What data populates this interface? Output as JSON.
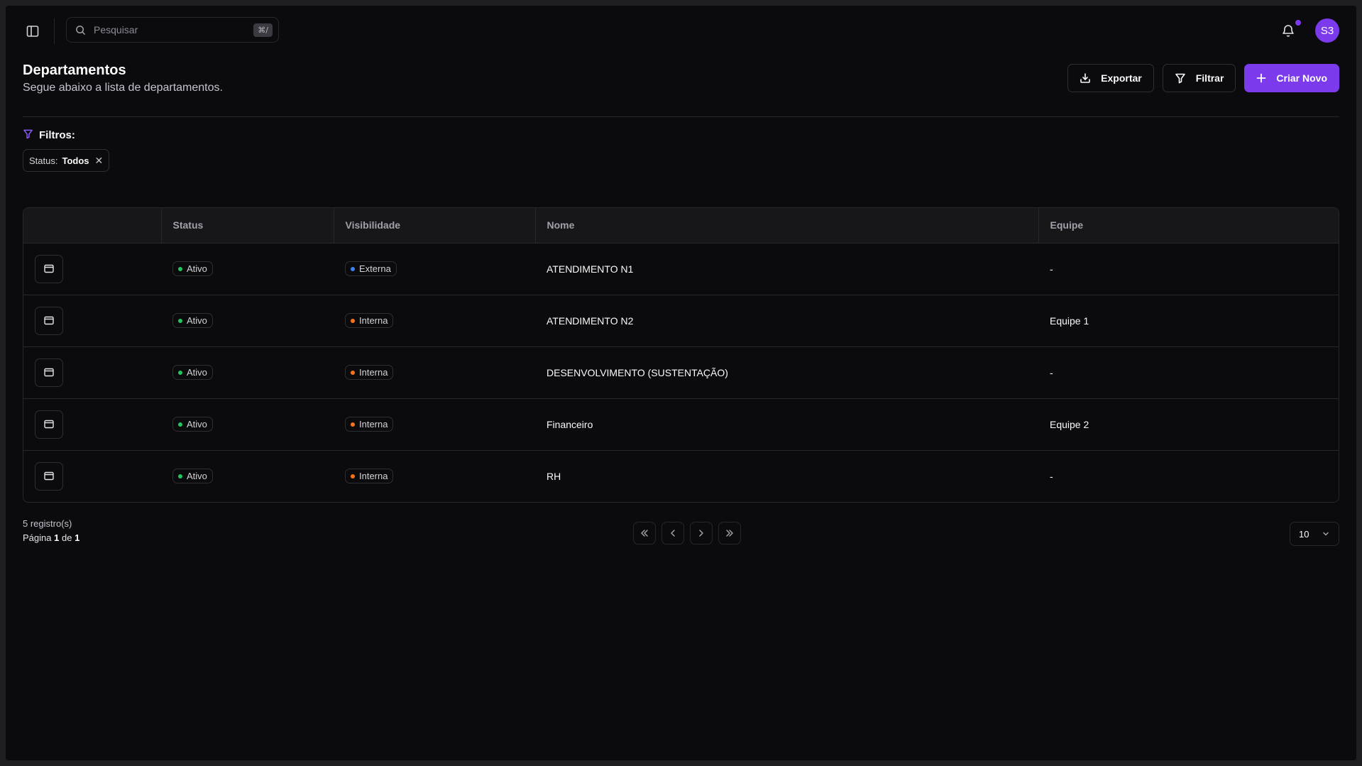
{
  "topbar": {
    "search_placeholder": "Pesquisar",
    "search_shortcut": "⌘/",
    "avatar_initials": "S3"
  },
  "header": {
    "title": "Departamentos",
    "subtitle": "Segue abaixo a lista de departamentos.",
    "export_label": "Exportar",
    "filter_label": "Filtrar",
    "create_label": "Criar Novo"
  },
  "filters": {
    "label": "Filtros:",
    "chips": [
      {
        "key": "Status:",
        "value": "Todos"
      }
    ]
  },
  "table": {
    "columns": [
      "",
      "Status",
      "Visibilidade",
      "Nome",
      "Equipe"
    ],
    "rows": [
      {
        "status": "Ativo",
        "visibility": "Externa",
        "visibility_color": "#3b82f6",
        "name": "ATENDIMENTO N1",
        "team": "-"
      },
      {
        "status": "Ativo",
        "visibility": "Interna",
        "visibility_color": "#f97316",
        "name": "ATENDIMENTO N2",
        "team": "Equipe 1"
      },
      {
        "status": "Ativo",
        "visibility": "Interna",
        "visibility_color": "#f97316",
        "name": "DESENVOLVIMENTO (SUSTENTAÇÃO)",
        "team": "-"
      },
      {
        "status": "Ativo",
        "visibility": "Interna",
        "visibility_color": "#f97316",
        "name": "Financeiro",
        "team": "Equipe 2"
      },
      {
        "status": "Ativo",
        "visibility": "Interna",
        "visibility_color": "#f97316",
        "name": "RH",
        "team": "-"
      }
    ]
  },
  "footer": {
    "record_count": "5 registro(s)",
    "page_prefix": "Página",
    "page_current": "1",
    "page_sep": "de",
    "page_total": "1",
    "per_page": "10"
  },
  "colors": {
    "accent": "#7c3aed",
    "status_active": "#22c55e",
    "background": "#0b0b0e"
  },
  "icons": {
    "sidebar_toggle": "sidebar-icon",
    "search": "search-icon",
    "bell": "bell-icon",
    "export": "download-icon",
    "filter": "filter-icon",
    "create": "plus-icon",
    "row": "browser-window-icon"
  }
}
